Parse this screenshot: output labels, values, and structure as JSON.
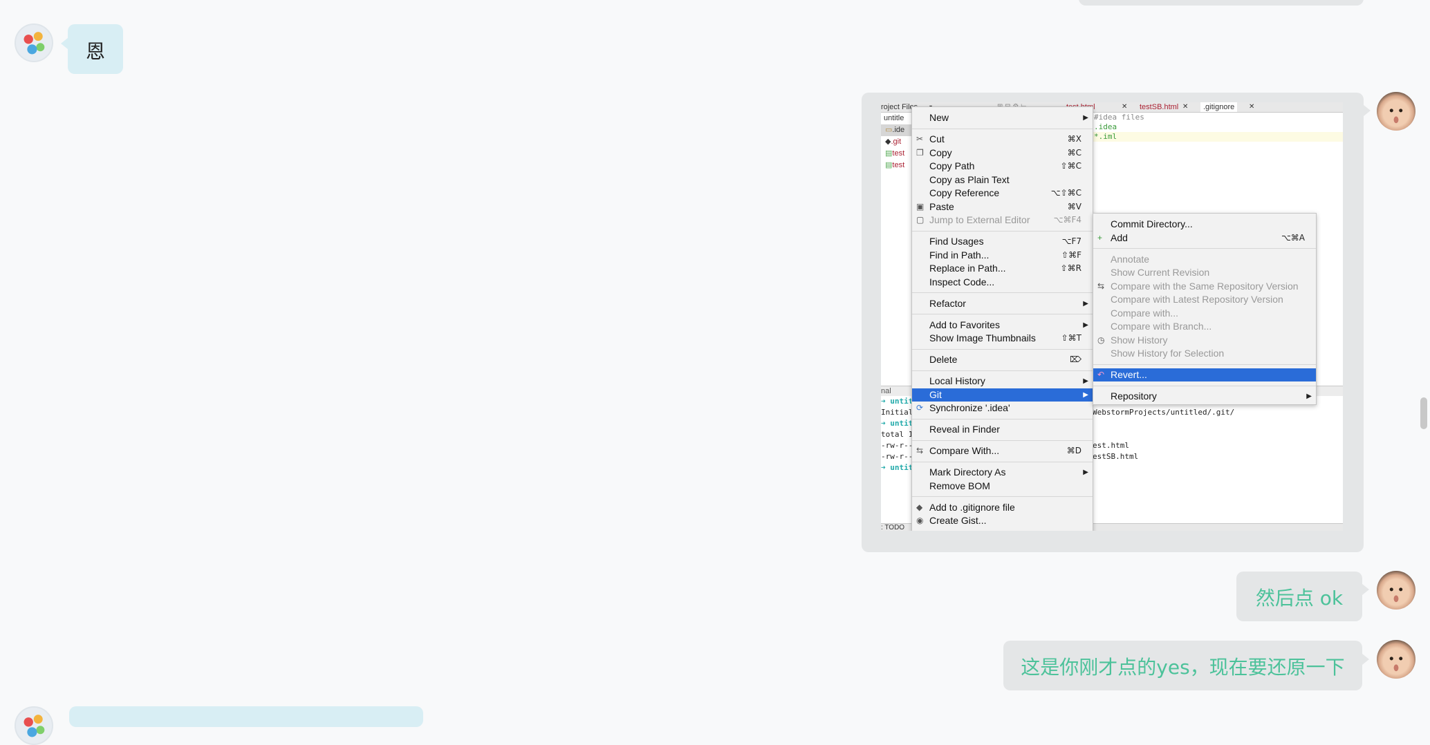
{
  "messages": {
    "m1_text": "恩",
    "m3_text": "然后点 ok",
    "m4_text": "这是你刚才点的yes，现在要还原一下"
  },
  "ide": {
    "top_label": "roject Files",
    "tabs": [
      "test.html",
      "testSB.html",
      ".gitignore"
    ],
    "tree": [
      "untitle",
      ".ide",
      ".git",
      "test",
      "test"
    ],
    "editor_lines": [
      "#idea files",
      ".idea",
      "*.iml"
    ],
    "terminal_label": "nal",
    "terminal_lines": [
      {
        "prefix": "➜ ",
        "host": "untit",
        "rest": ""
      },
      {
        "prefix": "",
        "host": "",
        "rest": "Initial",
        "tail": "WebstormProjects/untitled/.git/"
      },
      {
        "prefix": "➜ ",
        "host": "untit",
        "rest": ""
      },
      {
        "prefix": "",
        "host": "",
        "rest": "total 1(",
        "tail": ""
      },
      {
        "prefix": "",
        "host": "",
        "rest": "-rw-r--",
        "tail": "est.html"
      },
      {
        "prefix": "",
        "host": "",
        "rest": "-rw-r--",
        "tail": "estSB.html"
      },
      {
        "prefix": "➜ ",
        "host": "untit",
        "rest": ""
      }
    ],
    "bottom_label": ": TODO"
  },
  "context_menu": [
    {
      "label": "New",
      "shortcut": "",
      "arrow": true,
      "icon": "",
      "state": "normal"
    },
    {
      "sep": true
    },
    {
      "label": "Cut",
      "shortcut": "⌘X",
      "icon": "scissors-icon",
      "state": "normal"
    },
    {
      "label": "Copy",
      "shortcut": "⌘C",
      "icon": "copy-icon",
      "state": "normal"
    },
    {
      "label": "Copy Path",
      "shortcut": "⇧⌘C",
      "icon": "",
      "state": "normal"
    },
    {
      "label": "Copy as Plain Text",
      "shortcut": "",
      "icon": "",
      "state": "normal"
    },
    {
      "label": "Copy Reference",
      "shortcut": "⌥⇧⌘C",
      "icon": "",
      "state": "normal"
    },
    {
      "label": "Paste",
      "shortcut": "⌘V",
      "icon": "paste-icon",
      "state": "normal"
    },
    {
      "label": "Jump to External Editor",
      "shortcut": "⌥⌘F4",
      "icon": "external-editor-icon",
      "state": "disabled"
    },
    {
      "sep": true
    },
    {
      "label": "Find Usages",
      "shortcut": "⌥F7",
      "icon": "",
      "state": "normal"
    },
    {
      "label": "Find in Path...",
      "shortcut": "⇧⌘F",
      "icon": "",
      "state": "normal"
    },
    {
      "label": "Replace in Path...",
      "shortcut": "⇧⌘R",
      "icon": "",
      "state": "normal"
    },
    {
      "label": "Inspect Code...",
      "shortcut": "",
      "icon": "",
      "state": "normal"
    },
    {
      "sep": true
    },
    {
      "label": "Refactor",
      "arrow": true,
      "icon": "",
      "state": "normal"
    },
    {
      "sep": true
    },
    {
      "label": "Add to Favorites",
      "arrow": true,
      "icon": "",
      "state": "normal"
    },
    {
      "label": "Show Image Thumbnails",
      "shortcut": "⇧⌘T",
      "icon": "",
      "state": "normal"
    },
    {
      "sep": true
    },
    {
      "label": "Delete",
      "shortcut": "⌦",
      "icon": "",
      "state": "normal"
    },
    {
      "sep": true
    },
    {
      "label": "Local History",
      "arrow": true,
      "icon": "",
      "state": "normal"
    },
    {
      "label": "Git",
      "arrow": true,
      "icon": "",
      "state": "selected"
    },
    {
      "label": "Synchronize '.idea'",
      "shortcut": "",
      "icon": "sync-icon",
      "state": "normal"
    },
    {
      "sep": true
    },
    {
      "label": "Reveal in Finder",
      "shortcut": "",
      "icon": "",
      "state": "normal"
    },
    {
      "sep": true
    },
    {
      "label": "Compare With...",
      "shortcut": "⌘D",
      "icon": "compare-icon",
      "state": "normal"
    },
    {
      "sep": true
    },
    {
      "label": "Mark Directory As",
      "arrow": true,
      "icon": "",
      "state": "normal"
    },
    {
      "label": "Remove BOM",
      "shortcut": "",
      "icon": "",
      "state": "normal"
    },
    {
      "sep": true
    },
    {
      "label": "Add to .gitignore file",
      "shortcut": "",
      "icon": "gitignore-icon",
      "state": "normal"
    },
    {
      "label": "Create Gist...",
      "shortcut": "",
      "icon": "github-icon",
      "state": "normal"
    }
  ],
  "git_submenu": [
    {
      "label": "Commit Directory...",
      "shortcut": "",
      "icon": "",
      "state": "normal"
    },
    {
      "label": "Add",
      "shortcut": "⌥⌘A",
      "icon": "plus-icon",
      "state": "normal"
    },
    {
      "sep": true
    },
    {
      "label": "Annotate",
      "icon": "",
      "state": "disabled"
    },
    {
      "label": "Show Current Revision",
      "icon": "",
      "state": "disabled"
    },
    {
      "label": "Compare with the Same Repository Version",
      "icon": "compare-icon",
      "state": "disabled"
    },
    {
      "label": "Compare with Latest Repository Version",
      "icon": "",
      "state": "disabled"
    },
    {
      "label": "Compare with...",
      "icon": "",
      "state": "disabled"
    },
    {
      "label": "Compare with Branch...",
      "icon": "",
      "state": "disabled"
    },
    {
      "label": "Show History",
      "icon": "history-icon",
      "state": "disabled"
    },
    {
      "label": "Show History for Selection",
      "icon": "",
      "state": "disabled"
    },
    {
      "sep": true
    },
    {
      "label": "Revert...",
      "icon": "revert-icon",
      "state": "selected"
    },
    {
      "sep": true
    },
    {
      "label": "Repository",
      "arrow": true,
      "icon": "",
      "state": "normal"
    }
  ]
}
